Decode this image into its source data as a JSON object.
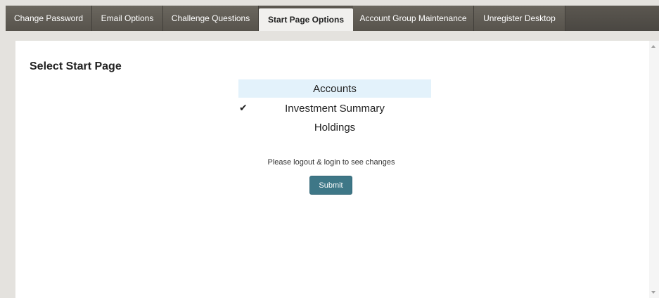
{
  "tabs": [
    {
      "label": "Change Password",
      "active": false
    },
    {
      "label": "Email Options",
      "active": false
    },
    {
      "label": "Challenge Questions",
      "active": false
    },
    {
      "label": "Start Page Options",
      "active": true
    },
    {
      "label": "Account Group Maintenance",
      "active": false
    },
    {
      "label": "Unregister Desktop",
      "active": false
    }
  ],
  "section": {
    "title": "Select Start Page"
  },
  "options": [
    {
      "label": "Accounts",
      "highlighted": true,
      "selected": false
    },
    {
      "label": "Investment Summary",
      "highlighted": false,
      "selected": true
    },
    {
      "label": "Holdings",
      "highlighted": false,
      "selected": false
    }
  ],
  "check_glyph": "✔",
  "note": "Please logout & login to see changes",
  "submit_label": "Submit",
  "colors": {
    "tabbar": "#4a4742",
    "highlight": "#e3f2fb",
    "button": "#3e7787"
  }
}
